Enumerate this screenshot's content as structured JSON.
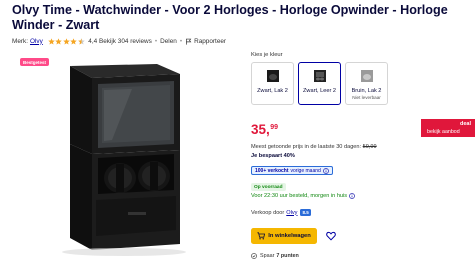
{
  "product": {
    "title": "Olvy Time - Watchwinder - Voor 2 Horloges - Horloge Opwinder - Horloge Winder - Zwart",
    "brand_label": "Merk:",
    "brand": "Olvy",
    "rating_value": 4.4,
    "rating_text": "4,4 Bekijk 304 reviews",
    "share_label": "Delen",
    "report_label": "Rapporteer",
    "badge": "Bestgetest"
  },
  "variants": {
    "label": "Kies je kleur",
    "items": [
      {
        "name": "Zwart, Lak 2",
        "sub": "",
        "selected": false
      },
      {
        "name": "Zwart, Leer 2",
        "sub": "",
        "selected": true
      },
      {
        "name": "Bruin, Lak 2",
        "sub": "Niet leverbaar",
        "selected": false
      }
    ]
  },
  "pricing": {
    "price_main": "35,",
    "price_cents": "99",
    "deal_title": "deal",
    "deal_sub": "bekijk aanbod",
    "lowest_text": "Meest getoonde prijs in de laatste 30 dagen:",
    "lowest_price": "59,99",
    "savings": "Je bespaart 40%"
  },
  "status": {
    "sold_bold": "100+ verkocht",
    "sold_rest": "vorige maand",
    "stock": "Op voorraad",
    "delivery": "Voor 22:30 uur besteld, morgen in huis"
  },
  "seller": {
    "label": "Verkoop door",
    "name": "Olvy",
    "score": "8.5"
  },
  "actions": {
    "cart_label": "In winkelwagen"
  },
  "loyalty": {
    "prefix": "Spaar",
    "points": "7 punten"
  },
  "colors": {
    "brand_blue": "#0000a4",
    "price_red": "#e0173b",
    "cart_yellow": "#f5b700",
    "stock_green": "#118811",
    "badge_pink": "#ff4a88"
  }
}
